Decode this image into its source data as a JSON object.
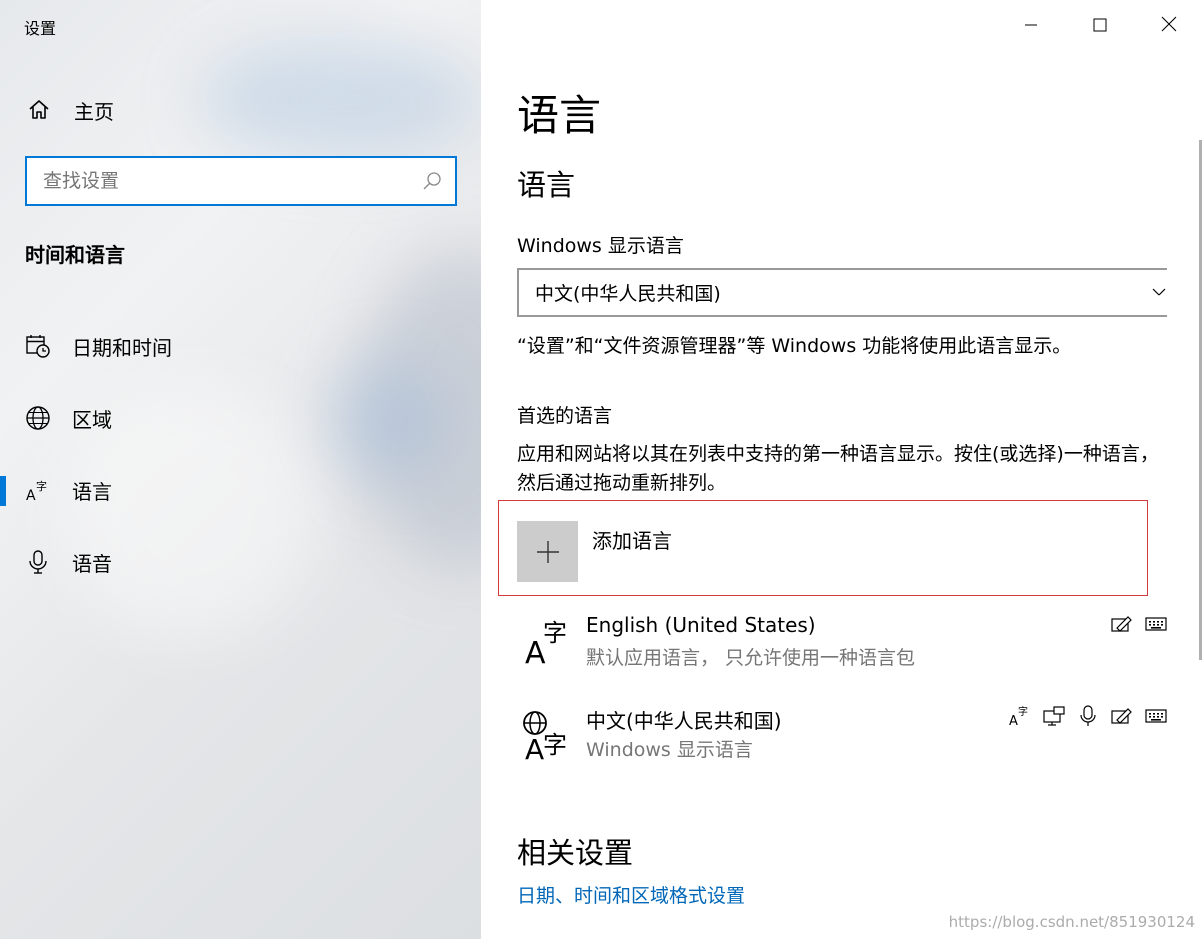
{
  "window": {
    "title": "设置",
    "controls": {
      "minimize_icon": "minimize-icon",
      "maximize_icon": "maximize-icon",
      "close_icon": "close-icon"
    }
  },
  "sidebar": {
    "home_label": "主页",
    "search": {
      "placeholder": "查找设置",
      "value": ""
    },
    "section_title": "时间和语言",
    "items": [
      {
        "label": "日期和时间",
        "icon": "calendar-clock-icon",
        "active": false
      },
      {
        "label": "区域",
        "icon": "globe-icon",
        "active": false
      },
      {
        "label": "语言",
        "icon": "language-icon",
        "active": true
      },
      {
        "label": "语音",
        "icon": "microphone-icon",
        "active": false
      }
    ]
  },
  "main": {
    "page_title": "语言",
    "section_title": "语言",
    "display_language": {
      "label": "Windows 显示语言",
      "selected": "中文(中华人民共和国)",
      "info": "“设置”和“文件资源管理器”等 Windows 功能将使用此语言显示。"
    },
    "preferred": {
      "label": "首选的语言",
      "description": "应用和网站将以其在列表中支持的第一种语言显示。按住(或选择)一种语言，然后通过拖动重新排列。",
      "add_label": "添加语言",
      "languages": [
        {
          "name": "English (United States)",
          "desc": "默认应用语言， 只允许使用一种语言包",
          "features": [
            "handwriting-icon",
            "keyboard-icon"
          ]
        },
        {
          "name": "中文(中华人民共和国)",
          "desc": "Windows 显示语言",
          "features": [
            "language-pack-icon",
            "display-icon",
            "microphone-icon",
            "handwriting-icon",
            "keyboard-icon"
          ]
        }
      ]
    },
    "related": {
      "title": "相关设置",
      "link": "日期、时间和区域格式设置"
    }
  },
  "watermark": "https://blog.csdn.net/851930124",
  "colors": {
    "accent": "#0078d7",
    "link": "#0067b8",
    "highlight_border": "#d33a3a"
  }
}
